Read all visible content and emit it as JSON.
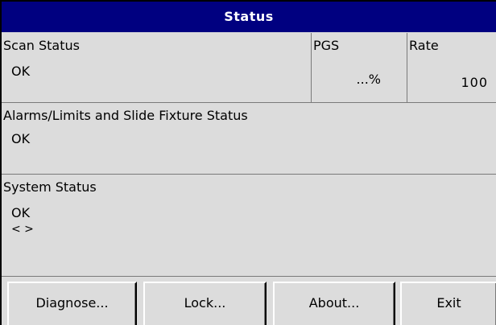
{
  "window": {
    "title": "Status"
  },
  "scan": {
    "label": "Scan Status",
    "value": "OK"
  },
  "pgs": {
    "label": "PGS",
    "value": "...%"
  },
  "rate": {
    "label": "Rate",
    "value": "100"
  },
  "alarms": {
    "label": "Alarms/Limits and Slide Fixture Status",
    "value": "OK"
  },
  "system": {
    "label": "System Status",
    "value": "OK",
    "extra": "< >"
  },
  "buttons": {
    "diagnose": "Diagnose...",
    "lock": "Lock...",
    "about": "About...",
    "exit": "Exit"
  }
}
